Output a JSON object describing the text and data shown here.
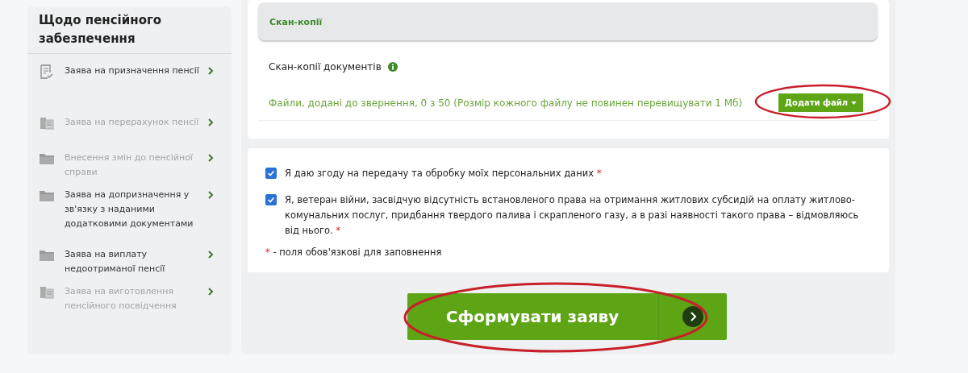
{
  "sidebar": {
    "title": "Щодо пенсійного забезпечення",
    "items": [
      {
        "label": "Заява на призначення пенсії",
        "kind": "document",
        "disabled": false
      },
      {
        "label": "Заява на перерахунок пенсії",
        "kind": "scan",
        "disabled": true
      },
      {
        "label": "Внесення змін до пенсійної справи",
        "kind": "folder",
        "disabled": true
      },
      {
        "label": "Заява на допризначення у зв'язку з наданими додатковими документами",
        "kind": "folder",
        "disabled": false
      },
      {
        "label": "Заява на виплату недоотриманої пенсії",
        "kind": "folder",
        "disabled": false
      },
      {
        "label": "Заява на виготовлення пенсійного посвідчення",
        "kind": "scan",
        "disabled": true
      }
    ]
  },
  "scans": {
    "section_title": "Скан-копії",
    "field_label": "Скан-копії документів",
    "files_note": "Файли, додані до звернення, 0 з 50 (Розмір кожного файлу не повинен перевищувати 1 Мб)",
    "add_button": {
      "label": "Додати файл",
      "circled": true
    }
  },
  "consents": [
    {
      "label": "Я даю згоду на передачу та обробку моїх персональних даних",
      "checked": true,
      "required_mark": "*"
    },
    {
      "label": "Я, ветеран війни, засвідчую відсутність встановленого права на отримання житлових субсидій на оплату житлово-комунальних послуг, придбання твердого палива і скрапленого газу, а в разі наявності такого права – відмовляюсь від нього.",
      "checked": true,
      "required_mark": "*"
    }
  ],
  "required_note": {
    "mark": "*",
    "text": "- поля обов'язкові для заповнення"
  },
  "submit_button": {
    "label": "Сформувати заяву",
    "circled": true
  }
}
